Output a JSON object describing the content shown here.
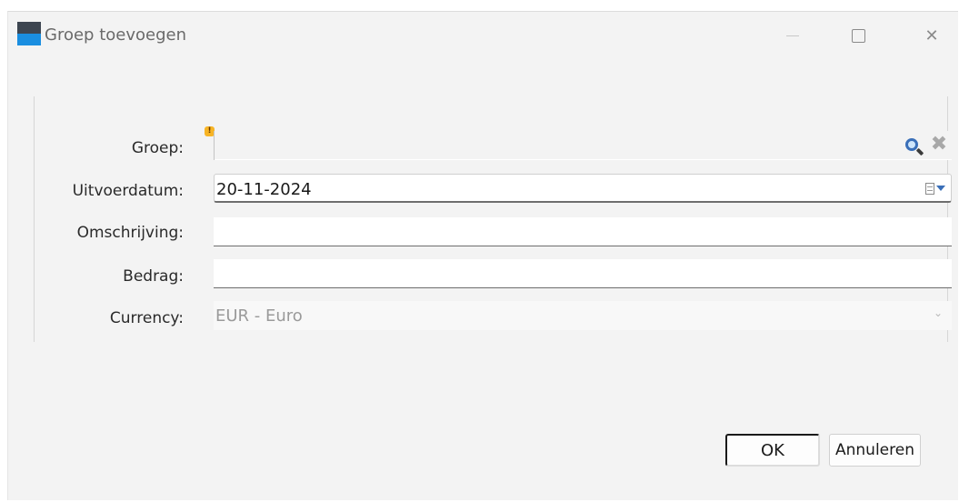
{
  "window": {
    "title": "Groep toevoegen",
    "controls": {
      "minimize": "—",
      "maximize": "☐",
      "close": "✕"
    }
  },
  "form": {
    "groep": {
      "label": "Groep:",
      "value": "",
      "warning_icon": "warning-icon"
    },
    "uitvoerdatum": {
      "label": "Uitvoerdatum:",
      "value": "20-11-2024"
    },
    "omschrijving": {
      "label": "Omschrijving:",
      "value": ""
    },
    "bedrag": {
      "label": "Bedrag:",
      "value": ""
    },
    "currency": {
      "label": "Currency:",
      "value": "EUR - Euro",
      "chevron": "⌄"
    }
  },
  "buttons": {
    "ok": "OK",
    "cancel": "Annuleren"
  },
  "icons": {
    "lookup": "magnifier-icon",
    "clear": "✖"
  },
  "colors": {
    "accent": "#1a8ee0",
    "warning": "#f7b425"
  }
}
